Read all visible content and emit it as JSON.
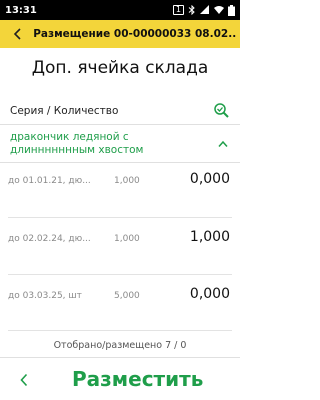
{
  "status_bar": {
    "time": "13:31",
    "sim_label": "1"
  },
  "header": {
    "title": "Размещение 00-00000033  08.02...."
  },
  "page_title": "Доп. ячейка склада",
  "section": {
    "label": "Серия / Количество"
  },
  "group": {
    "title": "дракончик ледяной с длиннннннным хвостом"
  },
  "rows": [
    {
      "series": "до 01.01.21, дю...",
      "quantity": "1,000",
      "placed": "0,000"
    },
    {
      "series": "до 02.02.24, дю...",
      "quantity": "1,000",
      "placed": "1,000"
    },
    {
      "series": "до 03.03.25, шт",
      "quantity": "5,000",
      "placed": "0,000"
    }
  ],
  "summary": "Отобрано/размещено  7 / 0",
  "bottom": {
    "action_label": "Разместить"
  },
  "colors": {
    "header_bg": "#f3d53a",
    "accent_green": "#1f9e4a"
  }
}
